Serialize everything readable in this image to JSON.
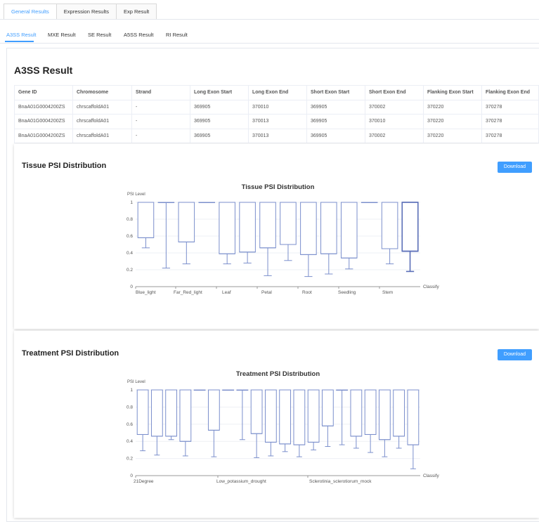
{
  "top_tabs": [
    "General Results",
    "Expression Results",
    "Exp Result"
  ],
  "sub_tabs": [
    "A3SS Result",
    "MXE Result",
    "SE Result",
    "A5SS Result",
    "RI Result"
  ],
  "panel_title": "A3SS Result",
  "table": {
    "headers": [
      "Gene ID",
      "Chromosome",
      "Strand",
      "Long Exon Start",
      "Long Exon End",
      "Short Exon Start",
      "Short Exon End",
      "Flanking Exon Start",
      "Flanking Exon End"
    ],
    "rows": [
      [
        "BnaA01G0004200ZS",
        "chrscaffoldA01",
        "-",
        "369905",
        "370010",
        "369905",
        "370002",
        "370220",
        "370278"
      ],
      [
        "BnaA01G0004200ZS",
        "chrscaffoldA01",
        "-",
        "369905",
        "370013",
        "369905",
        "370010",
        "370220",
        "370278"
      ],
      [
        "BnaA01G0004200ZS",
        "chrscaffoldA01",
        "-",
        "369905",
        "370013",
        "369905",
        "370002",
        "370220",
        "370278"
      ]
    ]
  },
  "download_label": "Download",
  "colors": {
    "accent": "#409eff",
    "box": "#7b8fcc",
    "box_highlight": "#5b6fb8"
  },
  "chart_data": [
    {
      "type": "boxplot",
      "card_title": "Tissue PSI Distribution",
      "title": "Tissue PSI Distribution",
      "ylabel": "PSI Level",
      "xlabel": "Classify",
      "ylim": [
        0,
        1
      ],
      "yticks": [
        "0",
        "0.2",
        "0.4",
        "0.6",
        "0.8",
        "1"
      ],
      "xtick_labels": [
        "Blue_light",
        "Far_Red_light",
        "Leaf",
        "Petal",
        "Root",
        "Seedling",
        "Stem"
      ],
      "boxes": [
        {
          "min": 0.46,
          "q1": 0.58,
          "median": 0.58,
          "q3": 1.0,
          "max": 1.0
        },
        {
          "min": 0.22,
          "q1": 1.0,
          "median": 1.0,
          "q3": 1.0,
          "max": 1.0
        },
        {
          "min": 0.27,
          "q1": 0.53,
          "median": 0.53,
          "q3": 1.0,
          "max": 1.0
        },
        {
          "min": 1.0,
          "q1": 1.0,
          "median": 1.0,
          "q3": 1.0,
          "max": 1.0
        },
        {
          "min": 0.27,
          "q1": 0.39,
          "median": 0.39,
          "q3": 1.0,
          "max": 1.0
        },
        {
          "min": 0.28,
          "q1": 0.41,
          "median": 0.41,
          "q3": 1.0,
          "max": 1.0
        },
        {
          "min": 0.13,
          "q1": 0.46,
          "median": 0.46,
          "q3": 1.0,
          "max": 1.0
        },
        {
          "min": 0.31,
          "q1": 0.5,
          "median": 0.5,
          "q3": 1.0,
          "max": 1.0
        },
        {
          "min": 0.12,
          "q1": 0.38,
          "median": 0.38,
          "q3": 1.0,
          "max": 1.0
        },
        {
          "min": 0.15,
          "q1": 0.39,
          "median": 0.39,
          "q3": 1.0,
          "max": 1.0
        },
        {
          "min": 0.21,
          "q1": 0.34,
          "median": 0.34,
          "q3": 1.0,
          "max": 1.0
        },
        {
          "min": 1.0,
          "q1": 1.0,
          "median": 1.0,
          "q3": 1.0,
          "max": 1.0
        },
        {
          "min": 0.27,
          "q1": 0.45,
          "median": 0.45,
          "q3": 1.0,
          "max": 1.0
        },
        {
          "min": 0.18,
          "q1": 0.42,
          "median": 0.42,
          "q3": 1.0,
          "max": 1.0
        }
      ]
    },
    {
      "type": "boxplot",
      "card_title": "Treatment PSI Distribution",
      "title": "Treatment PSI Distribution",
      "ylabel": "PSI Level",
      "xlabel": "Classify",
      "ylim": [
        0,
        1
      ],
      "yticks": [
        "0",
        "0.2",
        "0.4",
        "0.6",
        "0.8",
        "1"
      ],
      "xtick_labels": [
        "21Degree",
        "Low_potassium_drought",
        "Sclerotinia_sclerotiorum_mock"
      ],
      "boxes": [
        {
          "min": 0.29,
          "q1": 0.48,
          "median": 0.48,
          "q3": 1.0,
          "max": 1.0
        },
        {
          "min": 0.24,
          "q1": 0.46,
          "median": 0.46,
          "q3": 1.0,
          "max": 1.0
        },
        {
          "min": 0.42,
          "q1": 0.46,
          "median": 0.46,
          "q3": 1.0,
          "max": 1.0
        },
        {
          "min": 0.23,
          "q1": 0.4,
          "median": 0.4,
          "q3": 1.0,
          "max": 1.0
        },
        {
          "min": 1.0,
          "q1": 1.0,
          "median": 1.0,
          "q3": 1.0,
          "max": 1.0
        },
        {
          "min": 0.22,
          "q1": 0.53,
          "median": 0.53,
          "q3": 1.0,
          "max": 1.0
        },
        {
          "min": 1.0,
          "q1": 1.0,
          "median": 1.0,
          "q3": 1.0,
          "max": 1.0
        },
        {
          "min": 0.42,
          "q1": 1.0,
          "median": 1.0,
          "q3": 1.0,
          "max": 1.0
        },
        {
          "min": 0.21,
          "q1": 0.49,
          "median": 0.49,
          "q3": 1.0,
          "max": 1.0
        },
        {
          "min": 0.23,
          "q1": 0.39,
          "median": 0.39,
          "q3": 1.0,
          "max": 1.0
        },
        {
          "min": 0.28,
          "q1": 0.37,
          "median": 0.37,
          "q3": 1.0,
          "max": 1.0
        },
        {
          "min": 0.22,
          "q1": 0.36,
          "median": 0.36,
          "q3": 1.0,
          "max": 1.0
        },
        {
          "min": 0.3,
          "q1": 0.39,
          "median": 0.39,
          "q3": 1.0,
          "max": 1.0
        },
        {
          "min": 0.34,
          "q1": 0.58,
          "median": 0.58,
          "q3": 1.0,
          "max": 1.0
        },
        {
          "min": 0.36,
          "q1": 1.0,
          "median": 1.0,
          "q3": 1.0,
          "max": 1.0
        },
        {
          "min": 0.32,
          "q1": 0.46,
          "median": 0.46,
          "q3": 1.0,
          "max": 1.0
        },
        {
          "min": 0.27,
          "q1": 0.48,
          "median": 0.48,
          "q3": 1.0,
          "max": 1.0
        },
        {
          "min": 0.22,
          "q1": 0.42,
          "median": 0.42,
          "q3": 1.0,
          "max": 1.0
        },
        {
          "min": 0.32,
          "q1": 0.46,
          "median": 0.46,
          "q3": 1.0,
          "max": 1.0
        },
        {
          "min": 0.08,
          "q1": 0.36,
          "median": 0.36,
          "q3": 1.0,
          "max": 1.0
        }
      ]
    }
  ]
}
